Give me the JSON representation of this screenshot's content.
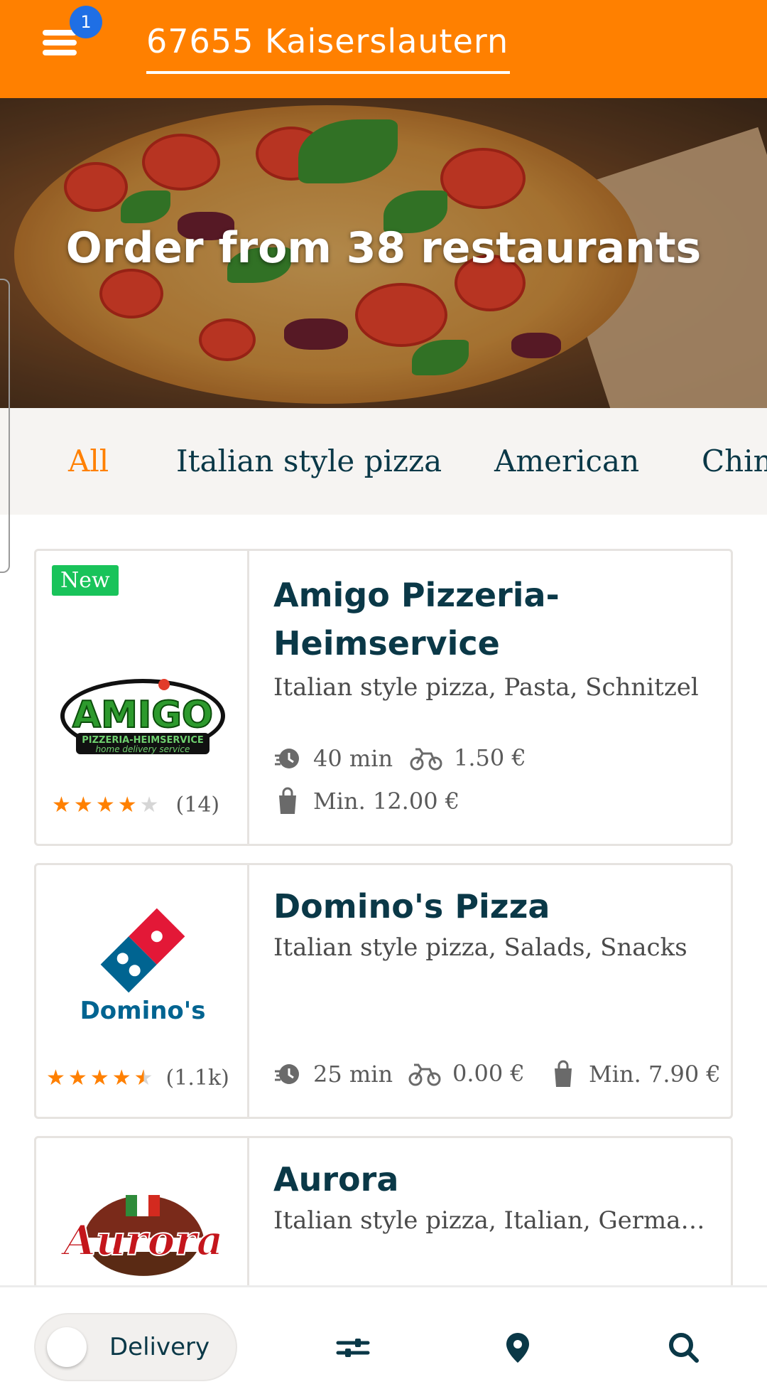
{
  "header": {
    "notification_count": "1",
    "location": "67655 Kaiserslautern"
  },
  "hero": {
    "title": "Order from 38 restaurants"
  },
  "categories": [
    "All",
    "Italian style pizza",
    "American",
    "Chin"
  ],
  "restaurants": [
    {
      "badge": "New",
      "name": "Amigo Pizzeria-Heimservice",
      "cuisines": "Italian style pizza, Pasta, Schnitzel",
      "rating": 4,
      "review_count": "(14)",
      "delivery_time": "40 min",
      "delivery_cost": "1.50 €",
      "min_order": "Min. 12.00 €",
      "logo_text": "AMIGO",
      "logo_subtext": "PIZZERIA-HEIMSERVICE",
      "logo_tagline": "home delivery service"
    },
    {
      "name": "Domino's Pizza",
      "cuisines": "Italian style pizza, Salads, Snacks",
      "rating": 4.5,
      "review_count": "(1.1k)",
      "delivery_time": "25 min",
      "delivery_cost": "0.00 €",
      "min_order": "Min. 7.90 €",
      "logo_text": "Domino's"
    },
    {
      "name": "Aurora",
      "cuisines": "Italian style pizza, Italian, German...",
      "logo_text": "Aurora"
    }
  ],
  "bottom_bar": {
    "toggle_label": "Delivery"
  },
  "colors": {
    "brand": "#ff8000",
    "text_dark": "#0a3847",
    "new_badge": "#19c35a",
    "notification": "#1f6fe5"
  }
}
